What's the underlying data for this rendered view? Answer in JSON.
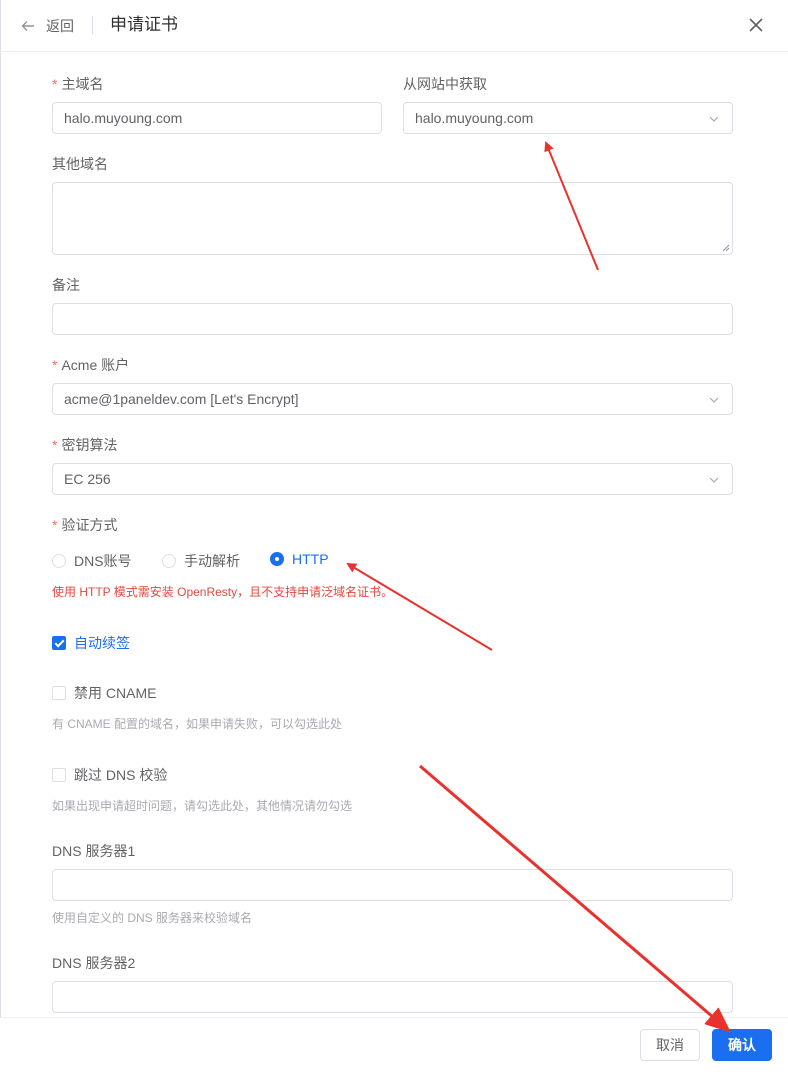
{
  "header": {
    "back_label": "返回",
    "title": "申请证书"
  },
  "form": {
    "primary_domain": {
      "label": "主域名",
      "required": true,
      "value": "halo.muyoung.com"
    },
    "from_website": {
      "label": "从网站中获取",
      "value": "halo.muyoung.com"
    },
    "other_domains": {
      "label": "其他域名",
      "value": ""
    },
    "remark": {
      "label": "备注",
      "value": ""
    },
    "acme_account": {
      "label": "Acme 账户",
      "required": true,
      "value": "acme@1paneldev.com [Let's Encrypt]"
    },
    "key_algorithm": {
      "label": "密钥算法",
      "required": true,
      "value": "EC 256"
    },
    "verify_method": {
      "label": "验证方式",
      "required": true,
      "options": [
        "DNS账号",
        "手动解析",
        "HTTP"
      ],
      "selected": "HTTP",
      "warning": "使用 HTTP 模式需安装 OpenResty，且不支持申请泛域名证书。"
    },
    "auto_renew": {
      "label": "自动续签",
      "checked": true
    },
    "disable_cname": {
      "label": "禁用 CNAME",
      "checked": false,
      "hint": "有 CNAME 配置的域名，如果申请失败，可以勾选此处"
    },
    "skip_dns_check": {
      "label": "跳过 DNS 校验",
      "checked": false,
      "hint": "如果出现申请超时问题，请勾选此处，其他情况请勿勾选"
    },
    "dns_server1": {
      "label": "DNS 服务器1",
      "value": "",
      "hint": "使用自定义的 DNS 服务器来校验域名"
    },
    "dns_server2": {
      "label": "DNS 服务器2",
      "value": ""
    }
  },
  "footer": {
    "cancel_label": "取消",
    "confirm_label": "确认"
  },
  "colors": {
    "primary": "#1a6ff0",
    "required_mark": "#f56c6c",
    "warning_text": "#e04a3f",
    "annotation_arrow": "#e8322d"
  },
  "icons": [
    "back-arrow-icon",
    "close-icon",
    "chevron-down-icon",
    "check-icon"
  ]
}
